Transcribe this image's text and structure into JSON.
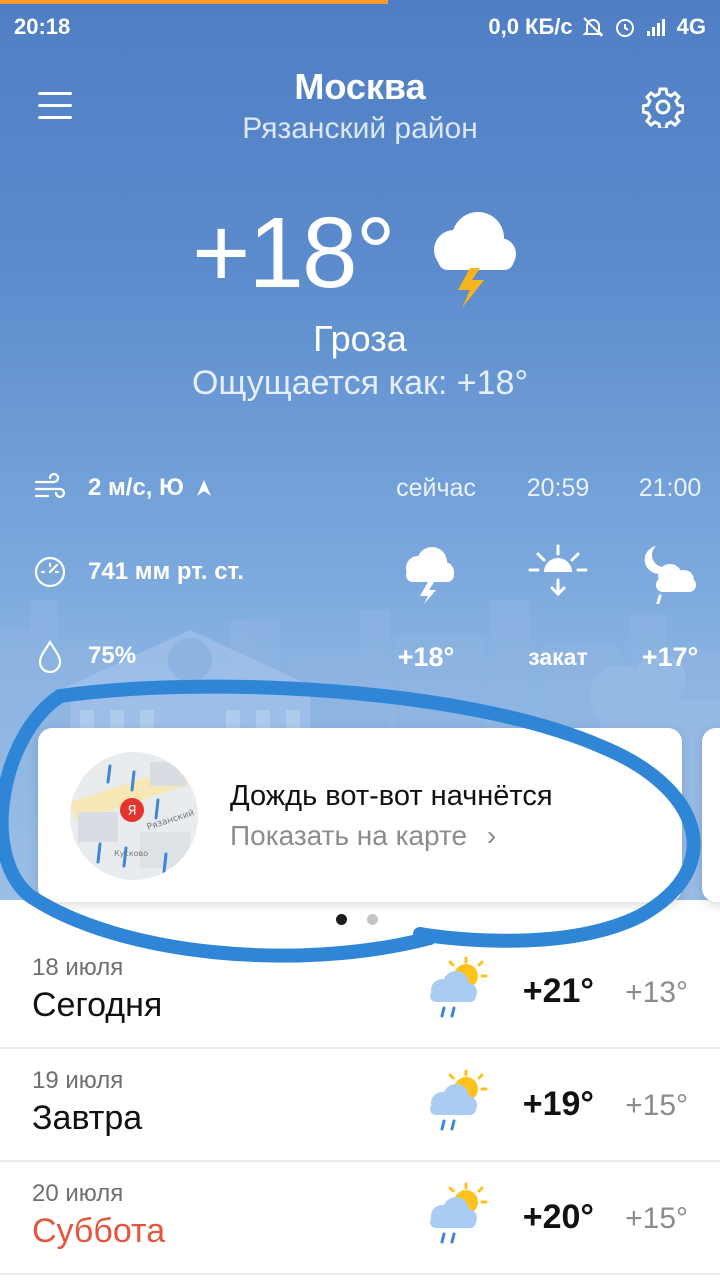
{
  "status_bar": {
    "time": "20:18",
    "network_speed": "0,0 КБ/с",
    "network_type": "4G",
    "icons": [
      "notifications-off-icon",
      "alarm-icon",
      "signal-icon"
    ]
  },
  "header": {
    "city": "Москва",
    "district": "Рязанский район",
    "menu_icon": "hamburger-menu-icon",
    "settings_icon": "gear-icon"
  },
  "current": {
    "temperature": "+18°",
    "icon": "thunderstorm-icon",
    "condition": "Гроза",
    "feels_like": "Ощущается как: +18°"
  },
  "metrics": {
    "wind": "2 м/с, Ю",
    "pressure": "741 мм рт. ст.",
    "humidity": "75%"
  },
  "hourly": [
    {
      "label": "сейчас",
      "icon": "thunderstorm-icon",
      "value": "+18°"
    },
    {
      "label": "20:59",
      "icon": "sunset-icon",
      "value": "закат"
    },
    {
      "label": "21:00",
      "icon": "night-cloudy-rain-icon",
      "value": "+17°"
    }
  ],
  "alert_card": {
    "title": "Дождь вот-вот начнётся",
    "link": "Показать на карте",
    "map_pin_letter": "Я",
    "map_street_label": "Рязанский",
    "map_place_label": "Кусково"
  },
  "pager": {
    "count": 2,
    "active": 0
  },
  "forecast": [
    {
      "date": "18 июля",
      "day": "Сегодня",
      "high": "+21°",
      "low": "+13°",
      "icon": "partly-cloudy-rain-icon",
      "weekend": false
    },
    {
      "date": "19 июля",
      "day": "Завтра",
      "high": "+19°",
      "low": "+15°",
      "icon": "partly-cloudy-rain-icon",
      "weekend": false
    },
    {
      "date": "20 июля",
      "day": "Суббота",
      "high": "+20°",
      "low": "+15°",
      "icon": "partly-cloudy-rain-icon",
      "weekend": true
    }
  ],
  "colors": {
    "sky_top": "#4f7ec4",
    "sky_bottom": "#a9cbee",
    "weekend": "#e5573c",
    "annotation_stroke": "#2f86d6",
    "progress": "#ff9a2e"
  }
}
